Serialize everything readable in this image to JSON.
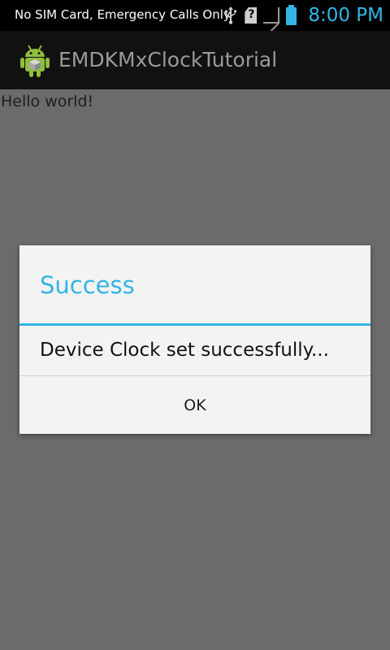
{
  "status_bar": {
    "carrier_text": "No SIM Card, Emergency Calls Only",
    "time": "8:00 PM",
    "icons": [
      "usb-icon",
      "sim-missing-icon",
      "signal-icon",
      "battery-icon"
    ]
  },
  "action_bar": {
    "app_icon": "android-icon",
    "title": "EMDKMxClockTutorial"
  },
  "content": {
    "hello_text": "Hello world!"
  },
  "dialog": {
    "title": "Success",
    "message": "Device Clock set successfully...",
    "ok_label": "OK"
  },
  "colors": {
    "accent": "#33b5e5",
    "status_bar_bg": "#000000",
    "action_bar_bg": "#111111",
    "content_dim_bg": "#6b6b6b",
    "dialog_bg": "#f3f3f3"
  }
}
